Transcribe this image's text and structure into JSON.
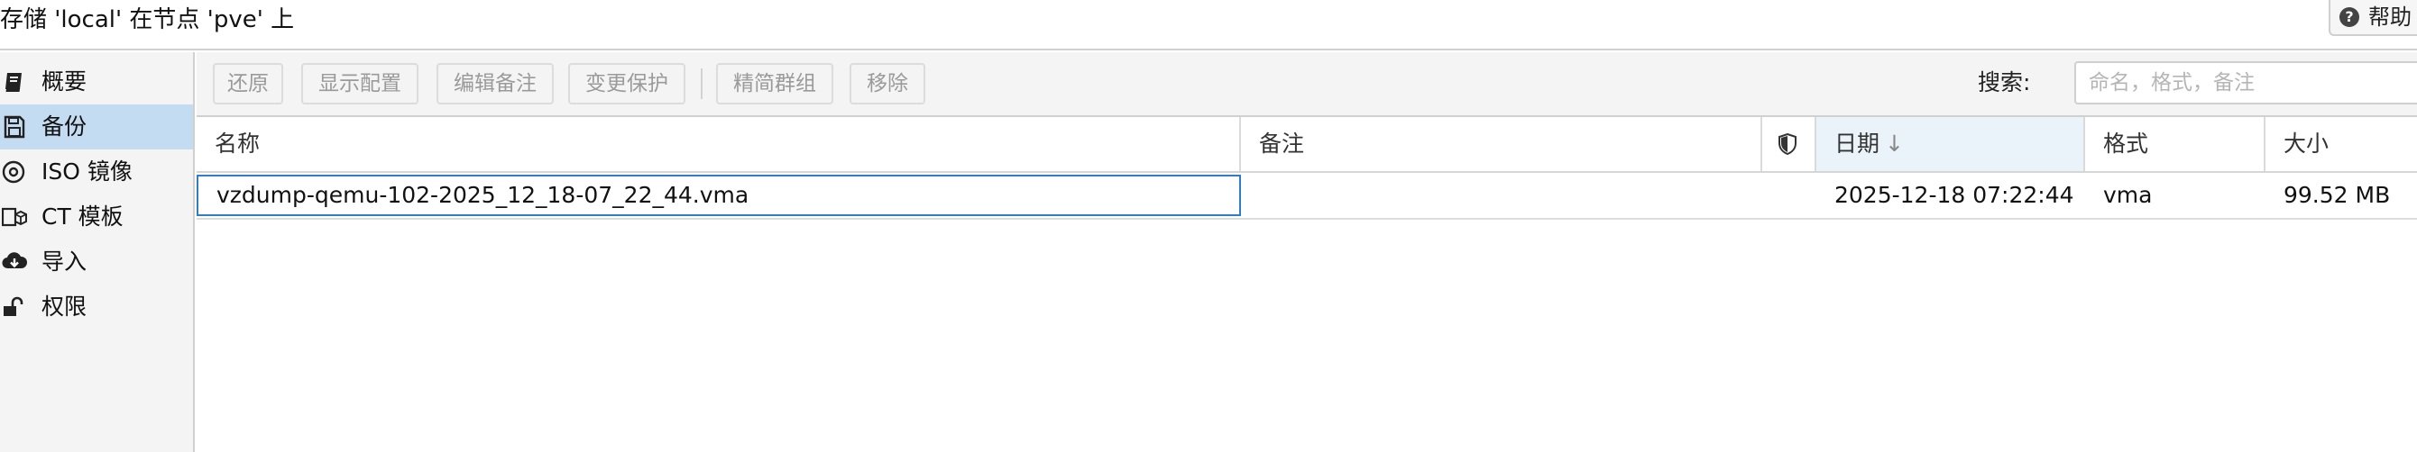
{
  "header": {
    "title": "存储 'local' 在节点 'pve' 上",
    "help_label": "帮助"
  },
  "sidebar": {
    "items": [
      {
        "label": "概要",
        "icon": "book-icon",
        "active": false
      },
      {
        "label": "备份",
        "icon": "floppy-disk-icon",
        "active": true
      },
      {
        "label": "ISO 镜像",
        "icon": "disc-icon",
        "active": false
      },
      {
        "label": "CT 模板",
        "icon": "cubes-icon",
        "active": false
      },
      {
        "label": "导入",
        "icon": "cloud-download-icon",
        "active": false
      },
      {
        "label": "权限",
        "icon": "unlock-icon",
        "active": false
      }
    ]
  },
  "toolbar": {
    "restore": "还原",
    "show_config": "显示配置",
    "edit_notes": "编辑备注",
    "change_protection": "变更保护",
    "prune_group": "精简群组",
    "remove": "移除",
    "search_label": "搜索:",
    "search_placeholder": "命名，格式，备注",
    "search_value": ""
  },
  "table": {
    "columns": {
      "name": "名称",
      "notes": "备注",
      "protected_icon": "shield-icon",
      "date": "日期",
      "date_sort": "descending",
      "format": "格式",
      "size": "大小"
    },
    "rows": [
      {
        "name": "vzdump-qemu-102-2025_12_18-07_22_44.vma",
        "notes": "",
        "date": "2025-12-18 07:22:44",
        "format": "vma",
        "size": "99.52 MB"
      }
    ]
  },
  "colors": {
    "accent": "#2f7cc9",
    "selected_nav": "#c4dcf2",
    "sorted_header": "#eaf2fa",
    "disabled_text": "#9a9a9a"
  }
}
